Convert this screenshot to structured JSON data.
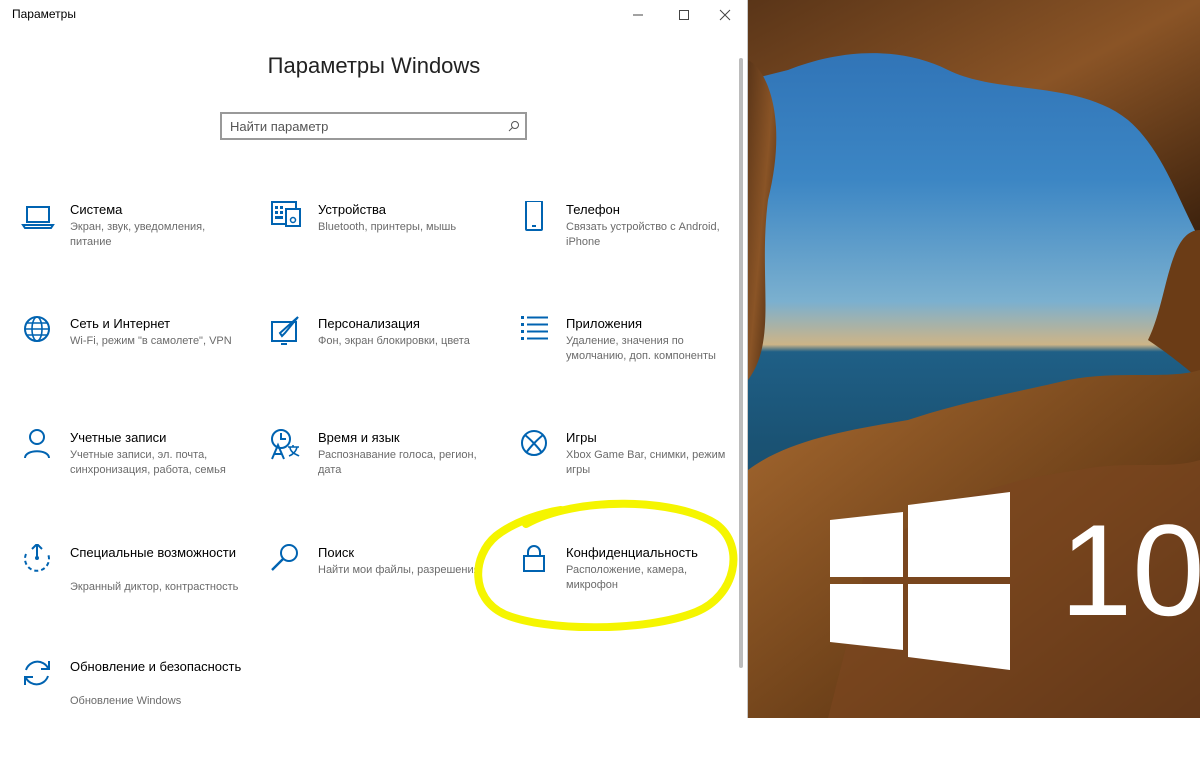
{
  "window": {
    "app_title": "Параметры",
    "heading": "Параметры Windows",
    "search_placeholder": "Найти параметр"
  },
  "tiles": [
    {
      "title": "Система",
      "desc": "Экран, звук, уведомления, питание",
      "icon": "laptop-icon"
    },
    {
      "title": "Устройства",
      "desc": "Bluetooth, принтеры, мышь",
      "icon": "keyboard-icon"
    },
    {
      "title": "Телефон",
      "desc": "Связать устройство с Android, iPhone",
      "icon": "phone-icon"
    },
    {
      "title": "Сеть и Интернет",
      "desc": "Wi-Fi, режим \"в самолете\", VPN",
      "icon": "globe-icon"
    },
    {
      "title": "Персонализация",
      "desc": "Фон, экран блокировки, цвета",
      "icon": "paint-brush-icon"
    },
    {
      "title": "Приложения",
      "desc": "Удаление, значения по умолчанию, доп. компоненты",
      "icon": "apps-list-icon"
    },
    {
      "title": "Учетные записи",
      "desc": "Учетные записи, эл. почта, синхронизация, работа, семья",
      "icon": "person-icon"
    },
    {
      "title": "Время и язык",
      "desc": "Распознавание голоса, регион, дата",
      "icon": "time-language-icon"
    },
    {
      "title": "Игры",
      "desc": "Xbox Game Bar, снимки, режим игры",
      "icon": "xbox-icon"
    },
    {
      "title": "Специальные возможности",
      "desc": "Экранный диктор, контрастность",
      "icon": "ease-of-access-icon"
    },
    {
      "title": "Поиск",
      "desc": "Найти мои файлы, разрешения",
      "icon": "search-icon"
    },
    {
      "title": "Конфиденциальность",
      "desc": "Расположение, камера, микрофон",
      "icon": "lock-icon"
    },
    {
      "title": "Обновление и безопасность",
      "desc": "Обновление Windows",
      "icon": "sync-icon"
    }
  ],
  "wallpaper": {
    "logo_text": "10"
  },
  "colors": {
    "accent": "#0063b1",
    "highlight": "#f5f500"
  }
}
